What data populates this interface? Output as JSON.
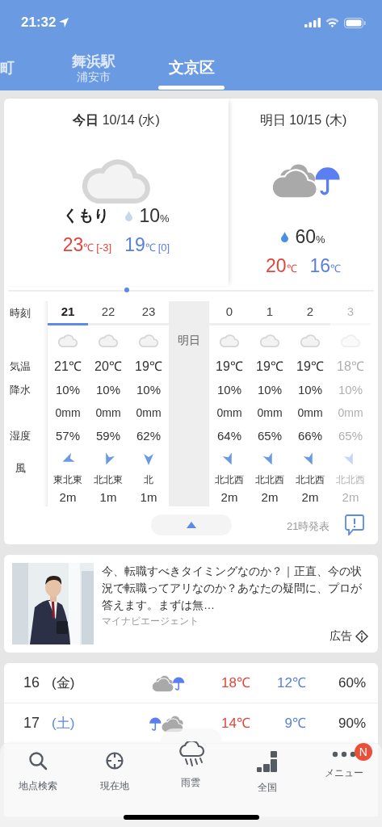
{
  "status_bar": {
    "time": "21:32"
  },
  "location_tabs": [
    {
      "label": "町",
      "selected": false
    },
    {
      "label": "舞浜駅",
      "sub": "浦安市",
      "selected": false
    },
    {
      "label": "文京区",
      "selected": true
    }
  ],
  "forecast_days": [
    {
      "heading": "**今日** 10/14 (水)",
      "weather": {
        "kind": "cloudy"
      },
      "condition": "くもり",
      "color": "#c5d8ea",
      "precip": "10",
      "precip_unit": "%",
      "high": "23",
      "high_unit": "℃",
      "high_diff": "[-3]",
      "low": "19",
      "low_unit": "℃",
      "low_diff": "[0]"
    },
    {
      "heading": "明日 10/15 (木)",
      "weather": {
        "kind": "cloudy_rain"
      },
      "color": "#4a90e2",
      "precip": "60",
      "precip_unit": "%",
      "high": "20",
      "high_unit": "℃",
      "low": "16",
      "low_unit": "℃"
    }
  ],
  "hourly": {
    "row_labels": [
      {
        "label": "時刻"
      },
      {
        "label": "気温"
      },
      {
        "label": "降水"
      },
      {
        "label": "湿度"
      },
      {
        "label": "風"
      }
    ],
    "columns": [
      {
        "kind": "hour",
        "hour": "21",
        "selected": true,
        "weather": {
          "kind": "cloudy"
        },
        "temp": "21℃",
        "precip": "10%",
        "rain": "0mm",
        "humidity": "57%",
        "arrow": {
          "kind": "ene"
        },
        "wind_dir": "東北東",
        "wind_speed": "2m"
      },
      {
        "kind": "hour",
        "hour": "22",
        "selected": false,
        "weather": {
          "kind": "cloudy"
        },
        "temp": "20℃",
        "precip": "10%",
        "rain": "0mm",
        "humidity": "59%",
        "arrow": {
          "kind": "nne"
        },
        "wind_dir": "北北東",
        "wind_speed": "1m"
      },
      {
        "kind": "hour",
        "hour": "23",
        "selected": false,
        "weather": {
          "kind": "cloudy"
        },
        "temp": "19℃",
        "precip": "10%",
        "rain": "0mm",
        "humidity": "62%",
        "arrow": {
          "kind": "n"
        },
        "wind_dir": "北",
        "wind_speed": "1m"
      },
      {
        "kind": "day_break",
        "label": "明日"
      },
      {
        "kind": "hour",
        "hour": "0",
        "selected": false,
        "weather": {
          "kind": "cloudy"
        },
        "temp": "19℃",
        "precip": "10%",
        "rain": "0mm",
        "humidity": "64%",
        "arrow": {
          "kind": "nnw"
        },
        "wind_dir": "北北西",
        "wind_speed": "2m"
      },
      {
        "kind": "hour",
        "hour": "1",
        "selected": false,
        "weather": {
          "kind": "cloudy"
        },
        "temp": "19℃",
        "precip": "10%",
        "rain": "0mm",
        "humidity": "65%",
        "arrow": {
          "kind": "nnw"
        },
        "wind_dir": "北北西",
        "wind_speed": "2m"
      },
      {
        "kind": "hour",
        "hour": "2",
        "selected": false,
        "weather": {
          "kind": "cloudy"
        },
        "temp": "19℃",
        "precip": "10%",
        "rain": "0mm",
        "humidity": "66%",
        "arrow": {
          "kind": "nnw"
        },
        "wind_dir": "北北西",
        "wind_speed": "2m"
      },
      {
        "kind": "hour",
        "hour": "3",
        "selected": false,
        "weather": {
          "kind": "cloudy"
        },
        "temp": "18℃",
        "precip": "10%",
        "rain": "0mm",
        "humidity": "65%",
        "arrow": {
          "kind": "nnw"
        },
        "wind_dir": "北北西",
        "wind_speed": "2m"
      }
    ],
    "issued": "21時発表"
  },
  "ad": {
    "kind": "picture",
    "text": "今、転職すべきタイミングなのか？｜正直、今の状況で転職ってアリなのか？あなたの疑問に、プロが答えます。まずは無…",
    "advertiser": "マイナビエージェント",
    "label": "広告"
  },
  "daily": [
    {
      "day": "16",
      "weekday": "(金)",
      "color": "#333333",
      "weather": {
        "kind": "cloudy_rain"
      },
      "high": "18℃",
      "low": "12℃",
      "precip": "60%"
    },
    {
      "day": "17",
      "weekday": "(土)",
      "color": "#5b86e5",
      "weather": {
        "kind": "rain_cloudy"
      },
      "high": "14℃",
      "low": "9℃",
      "precip": "90%"
    }
  ],
  "nav": [
    {
      "label": "地点検索",
      "kind": "search"
    },
    {
      "label": "現在地",
      "kind": "crosshair"
    },
    {
      "label": "雨雲",
      "kind": "rain",
      "raised": true
    },
    {
      "label": "全国",
      "kind": "blocks"
    },
    {
      "label": "メニュー",
      "kind": "dots",
      "badge": "N"
    }
  ]
}
